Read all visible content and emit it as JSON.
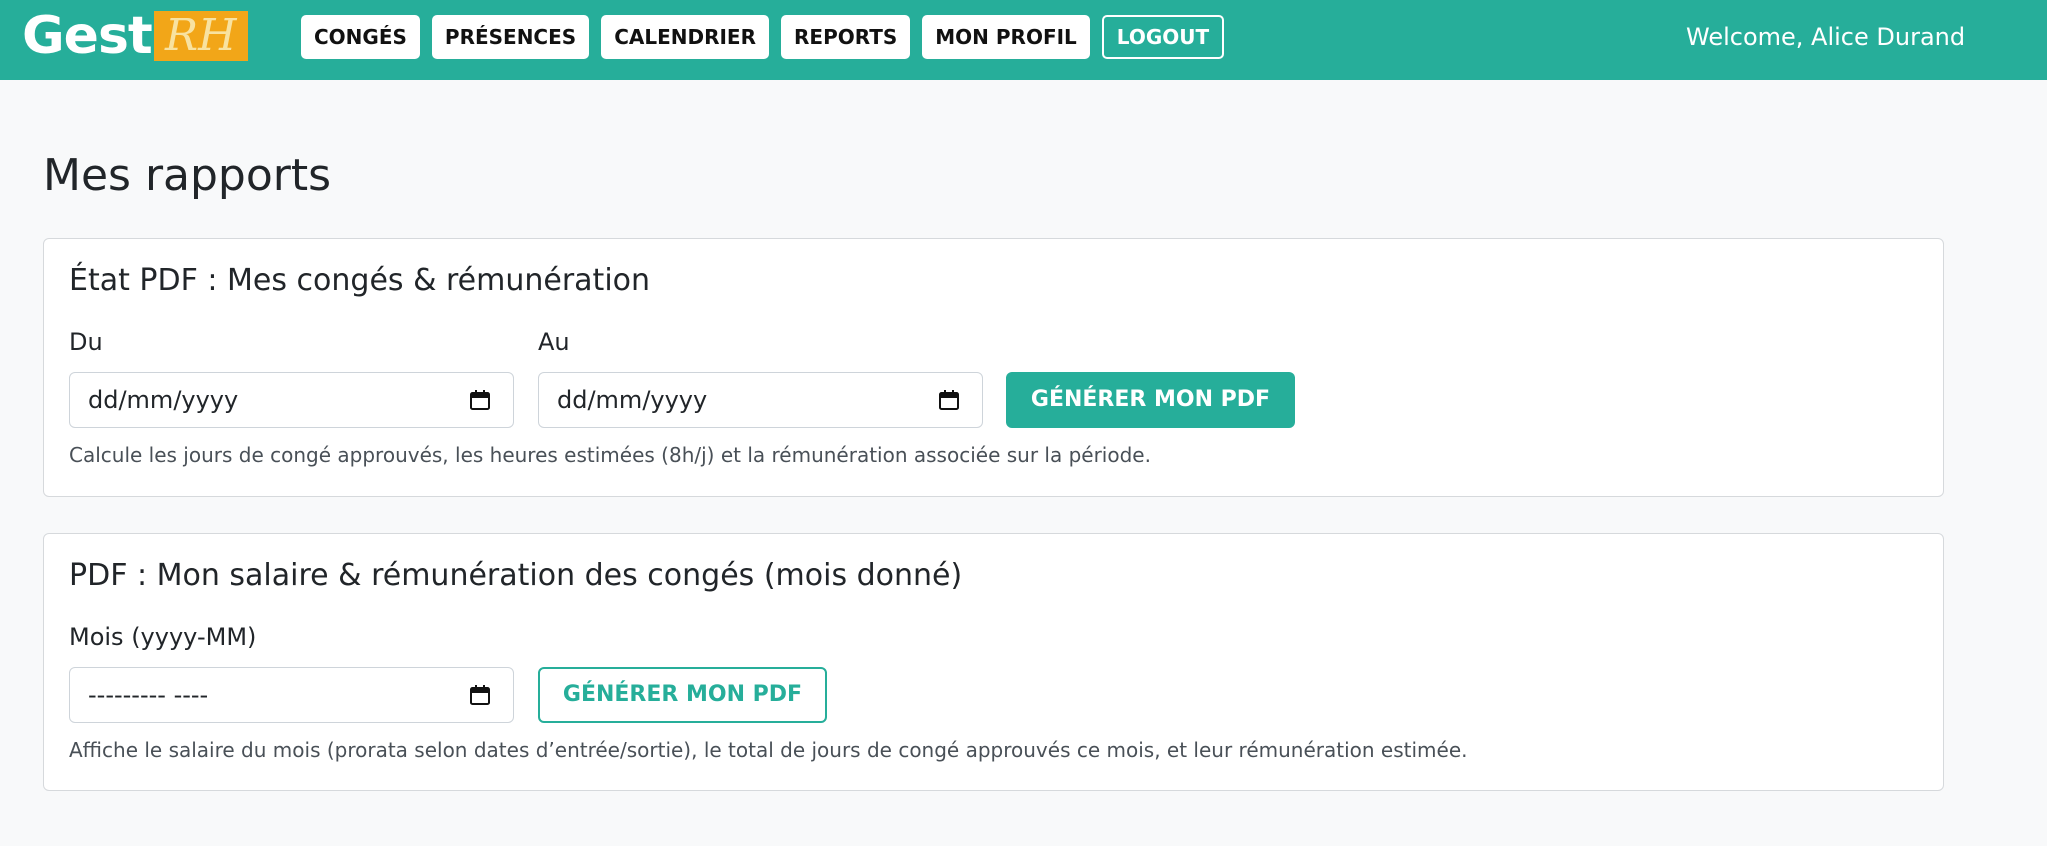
{
  "header": {
    "logo_word": "Gest",
    "logo_rh": "RH",
    "nav": [
      "CONGÉS",
      "PRÉSENCES",
      "CALENDRIER",
      "REPORTS",
      "MON PROFIL"
    ],
    "logout_label": "LOGOUT",
    "welcome": "Welcome, Alice Durand"
  },
  "page": {
    "title": "Mes rapports"
  },
  "card1": {
    "title": "État PDF : Mes congés & rémunération",
    "from_label": "Du",
    "from_value": "dd/mm/yyyy",
    "to_label": "Au",
    "to_value": "dd/mm/yyyy",
    "button": "GÉNÉRER MON PDF",
    "help": "Calcule les jours de congé approuvés, les heures estimées (8h/j) et la rémunération associée sur la période."
  },
  "card2": {
    "title": "PDF : Mon salaire & rémunération des congés (mois donné)",
    "month_label": "Mois (yyyy-MM)",
    "month_value": "--------- ----",
    "button": "GÉNÉRER MON PDF",
    "help": "Affiche le salaire du mois (prorata selon dates d’entrée/sortie), le total de jours de congé approuvés ce mois, et leur rémunération estimée."
  },
  "colors": {
    "accent": "#26ae9a",
    "logo_rh_bg": "#f2a618"
  },
  "icons": {
    "date_picker": "calendar-icon"
  }
}
